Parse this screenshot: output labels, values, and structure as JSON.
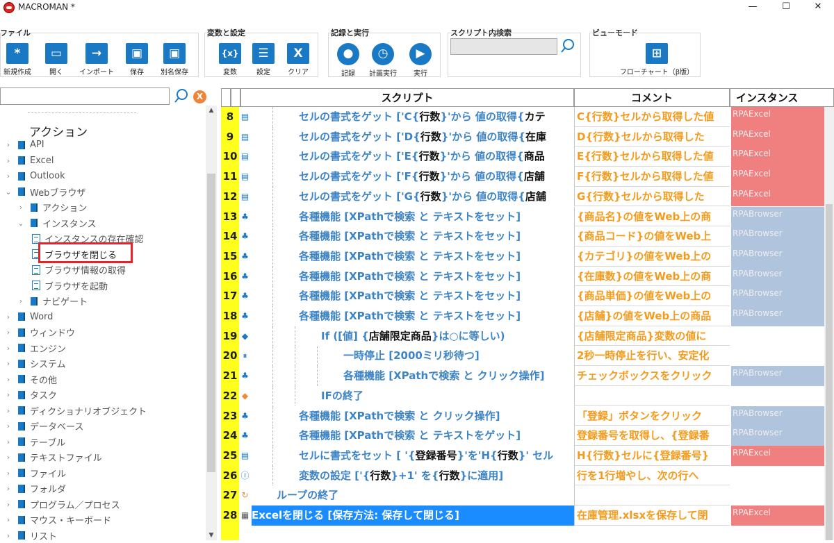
{
  "window": {
    "title": "MACROMAN *",
    "controls": [
      "—",
      "☐",
      "✕"
    ]
  },
  "ribbon": {
    "groups": [
      {
        "title": "ファイル",
        "buttons": [
          {
            "label": "新規作成",
            "icon": "new-icon",
            "glyph": "*"
          },
          {
            "label": "開く",
            "icon": "folder-icon",
            "glyph": "▭"
          },
          {
            "label": "インポート",
            "icon": "import-arrow-icon",
            "glyph": "→"
          },
          {
            "label": "保存",
            "icon": "save-icon",
            "glyph": "▣"
          },
          {
            "label": "別名保存",
            "icon": "save-as-icon",
            "glyph": "▣"
          }
        ]
      },
      {
        "title": "変数と設定",
        "buttons": [
          {
            "label": "変数",
            "icon": "variable-icon",
            "glyph": "{x}"
          },
          {
            "label": "設定",
            "icon": "settings-menu-icon",
            "glyph": "☰"
          },
          {
            "label": "クリア",
            "icon": "clear-icon",
            "glyph": "X"
          }
        ]
      },
      {
        "title": "記録と実行",
        "buttons": [
          {
            "label": "記録",
            "icon": "record-icon",
            "glyph": "●"
          },
          {
            "label": "計画実行",
            "icon": "schedule-icon",
            "glyph": "◷"
          },
          {
            "label": "実行",
            "icon": "run-icon",
            "glyph": "▶"
          }
        ]
      },
      {
        "title": "スクリプト内検索",
        "buttons": []
      },
      {
        "title": "ビューモード",
        "buttons": [
          {
            "label": "フローチャート（β版）",
            "icon": "flowchart-icon",
            "glyph": "⊞"
          }
        ]
      }
    ],
    "search_value": ""
  },
  "left_panel": {
    "search_value": "",
    "clear_label": "X",
    "heading": "アクション",
    "items": [
      {
        "label": "API",
        "level": 0,
        "type": "book",
        "expanded": false
      },
      {
        "label": "Excel",
        "level": 0,
        "type": "book",
        "expanded": false
      },
      {
        "label": "Outlook",
        "level": 0,
        "type": "book",
        "expanded": false
      },
      {
        "label": "Webブラウザ",
        "level": 0,
        "type": "book",
        "expanded": true
      },
      {
        "label": "アクション",
        "level": 1,
        "type": "book",
        "expanded": false
      },
      {
        "label": "インスタンス",
        "level": 1,
        "type": "book",
        "expanded": true
      },
      {
        "label": "インスタンスの存在確認",
        "level": 2,
        "type": "page"
      },
      {
        "label": "ブラウザを閉じる",
        "level": 2,
        "type": "page",
        "highlighted": true
      },
      {
        "label": "ブラウザ情報の取得",
        "level": 2,
        "type": "page"
      },
      {
        "label": "ブラウザを起動",
        "level": 2,
        "type": "page"
      },
      {
        "label": "ナビゲート",
        "level": 1,
        "type": "book",
        "expanded": false
      },
      {
        "label": "Word",
        "level": 0,
        "type": "book",
        "expanded": false
      },
      {
        "label": "ウィンドウ",
        "level": 0,
        "type": "book",
        "expanded": false
      },
      {
        "label": "エンジン",
        "level": 0,
        "type": "book",
        "expanded": false
      },
      {
        "label": "システム",
        "level": 0,
        "type": "book",
        "expanded": false
      },
      {
        "label": "その他",
        "level": 0,
        "type": "book",
        "expanded": false
      },
      {
        "label": "タスク",
        "level": 0,
        "type": "book",
        "expanded": false
      },
      {
        "label": "ディクショナリオブジェクト",
        "level": 0,
        "type": "book",
        "expanded": false
      },
      {
        "label": "データベース",
        "level": 0,
        "type": "book",
        "expanded": false
      },
      {
        "label": "テーブル",
        "level": 0,
        "type": "book",
        "expanded": false
      },
      {
        "label": "テキストファイル",
        "level": 0,
        "type": "book",
        "expanded": false
      },
      {
        "label": "ファイル",
        "level": 0,
        "type": "book",
        "expanded": false
      },
      {
        "label": "フォルダ",
        "level": 0,
        "type": "book",
        "expanded": false
      },
      {
        "label": "プログラム／プロセス",
        "level": 0,
        "type": "book",
        "expanded": false
      },
      {
        "label": "マウス・キーボード",
        "level": 0,
        "type": "book",
        "expanded": false
      },
      {
        "label": "リスト",
        "level": 0,
        "type": "book",
        "expanded": false
      }
    ]
  },
  "grid": {
    "headers": {
      "script": "スクリプト",
      "comment": "コメント",
      "instance": "インスタンス"
    },
    "instance_colors": {
      "RPAExcel": "#f08080",
      "RPABrowser": "#b0c4de"
    },
    "rows": [
      {
        "num": "8",
        "icon": "cell-icon",
        "indent": 2,
        "parts": [
          [
            "セルの書式をゲット ['C{",
            0
          ],
          [
            "行数",
            1
          ],
          [
            "}'から 値の取得{",
            0
          ],
          [
            "カテ",
            1
          ]
        ],
        "comment": "C{行数}セルから取得した値",
        "instance": "RPAExcel"
      },
      {
        "num": "9",
        "icon": "cell-icon",
        "indent": 2,
        "parts": [
          [
            "セルの書式をゲット ['D{",
            0
          ],
          [
            "行数",
            1
          ],
          [
            "}'から 値の取得{",
            0
          ],
          [
            "在庫",
            1
          ]
        ],
        "comment": "D{行数}セルから取得した",
        "instance": "RPAExcel"
      },
      {
        "num": "10",
        "icon": "cell-icon",
        "indent": 2,
        "parts": [
          [
            "セルの書式をゲット ['E{",
            0
          ],
          [
            "行数",
            1
          ],
          [
            "}'から 値の取得{",
            0
          ],
          [
            "商品",
            1
          ]
        ],
        "comment": "E{行数}セルから取得した値",
        "instance": "RPAExcel"
      },
      {
        "num": "11",
        "icon": "cell-icon",
        "indent": 2,
        "parts": [
          [
            "セルの書式をゲット ['F{",
            0
          ],
          [
            "行数",
            1
          ],
          [
            "}'から 値の取得{",
            0
          ],
          [
            "店舗",
            1
          ]
        ],
        "comment": "F{行数}セルから取得した値",
        "instance": "RPAExcel"
      },
      {
        "num": "12",
        "icon": "cell-icon",
        "indent": 2,
        "parts": [
          [
            "セルの書式をゲット ['G{",
            0
          ],
          [
            "行数",
            1
          ],
          [
            "}'から 値の取得{",
            0
          ],
          [
            "店舗",
            1
          ]
        ],
        "comment": "G{行数}セルから取得した",
        "instance": "RPAExcel"
      },
      {
        "num": "13",
        "icon": "browser-action-icon",
        "indent": 2,
        "parts": [
          [
            "各種機能 [XPathで検索 と テキストをセット]",
            0
          ]
        ],
        "comment": "{商品名}の値をWeb上の商",
        "instance": "RPABrowser"
      },
      {
        "num": "14",
        "icon": "browser-action-icon",
        "indent": 2,
        "parts": [
          [
            "各種機能 [XPathで検索 と テキストをセット]",
            0
          ]
        ],
        "comment": "{商品コード}の値をWeb上",
        "instance": "RPABrowser"
      },
      {
        "num": "15",
        "icon": "browser-action-icon",
        "indent": 2,
        "parts": [
          [
            "各種機能 [XPathで検索 と テキストをセット]",
            0
          ]
        ],
        "comment": "{カテゴリ}の値をWeb上の",
        "instance": "RPABrowser"
      },
      {
        "num": "16",
        "icon": "browser-action-icon",
        "indent": 2,
        "parts": [
          [
            "各種機能 [XPathで検索 と テキストをセット]",
            0
          ]
        ],
        "comment": "{在庫数}の値をWeb上の商",
        "instance": "RPABrowser"
      },
      {
        "num": "17",
        "icon": "browser-action-icon",
        "indent": 2,
        "parts": [
          [
            "各種機能 [XPathで検索 と テキストをセット]",
            0
          ]
        ],
        "comment": "{商品単価}の値をWeb上の",
        "instance": "RPABrowser"
      },
      {
        "num": "18",
        "icon": "browser-action-icon",
        "indent": 2,
        "parts": [
          [
            "各種機能 [XPathで検索 と テキストをセット]",
            0
          ]
        ],
        "comment": "{店舗}の値をWeb上の商品",
        "instance": "RPABrowser"
      },
      {
        "num": "19",
        "icon": "if-diamond-icon",
        "indent": 3,
        "parts": [
          [
            "If ([値] {",
            0
          ],
          [
            "店舗限定商品",
            1
          ],
          [
            "}は○に等しい)",
            0
          ]
        ],
        "comment": "{店舗限定商品}変数の値に",
        "instance": ""
      },
      {
        "num": "20",
        "icon": "pause-icon",
        "indent": 4,
        "parts": [
          [
            "一時停止 [2000ミリ秒待つ]",
            0
          ]
        ],
        "comment": "2秒一時停止を行い、安定化",
        "instance": ""
      },
      {
        "num": "21",
        "icon": "browser-action-icon",
        "indent": 4,
        "parts": [
          [
            "各種機能 [XPathで検索 と クリック操作]",
            0
          ]
        ],
        "comment": "チェックボックスをクリック",
        "instance": "RPABrowser"
      },
      {
        "num": "22",
        "icon": "end-if-diamond-icon",
        "indent": 3,
        "parts": [
          [
            "IFの終了",
            0
          ]
        ],
        "comment": "",
        "instance": ""
      },
      {
        "num": "23",
        "icon": "browser-action-icon",
        "indent": 2,
        "parts": [
          [
            "各種機能 [XPathで検索 と クリック操作]",
            0
          ]
        ],
        "comment": "「登録」ボタンをクリック",
        "instance": "RPABrowser"
      },
      {
        "num": "24",
        "icon": "browser-action-icon",
        "indent": 2,
        "parts": [
          [
            "各種機能 [XPathで検索 と テキストをゲット]",
            0
          ]
        ],
        "comment": "登録番号を取得し、{登録番",
        "instance": "RPABrowser"
      },
      {
        "num": "25",
        "icon": "cell-icon",
        "indent": 2,
        "parts": [
          [
            "セルに書式をセット [ '{",
            0
          ],
          [
            "登録番号",
            1
          ],
          [
            "}'を'H{",
            0
          ],
          [
            "行数",
            1
          ],
          [
            "}' セル",
            0
          ]
        ],
        "comment": "H{行数}セルに{登録番号}",
        "instance": "RPAExcel"
      },
      {
        "num": "26",
        "icon": "variable-set-icon",
        "indent": 2,
        "parts": [
          [
            "変数の設定 ['{",
            0
          ],
          [
            "行数",
            1
          ],
          [
            "}+1' を{",
            0
          ],
          [
            "行数",
            1
          ],
          [
            "}に適用]",
            0
          ]
        ],
        "comment": "行を1行増やし、次の行へ",
        "instance": ""
      },
      {
        "num": "27",
        "icon": "loop-end-icon",
        "indent": 1,
        "parts": [
          [
            "ループの終了",
            0
          ]
        ],
        "comment": "",
        "instance": ""
      },
      {
        "num": "28",
        "icon": "table-grid-icon",
        "indent": 0,
        "parts": [
          [
            "Excelを閉じる [保存方法: 保存して閉じる]",
            0
          ]
        ],
        "comment": "在庫管理.xlsxを保存して閉",
        "instance": "RPAExcel",
        "selected": true
      }
    ]
  }
}
